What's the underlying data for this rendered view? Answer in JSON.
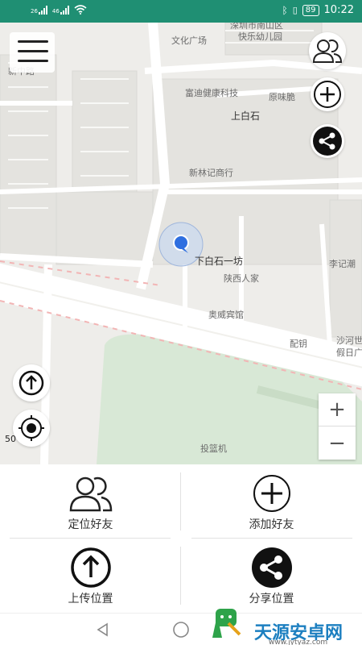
{
  "status_bar": {
    "signal1": "26",
    "signal2": "46",
    "battery": "89",
    "time": "10:22"
  },
  "map": {
    "labels": {
      "shenzhen_nanshan": "深圳市南山区",
      "kuaile_kindergarten": "快乐幼儿园",
      "wenhua_plaza": "文化广场",
      "xinzhong_road": "新中路",
      "fudi_tech": "富迪健康科技",
      "yuanwei": "原味脆",
      "shangbaishi": "上白石",
      "xinlinji": "新林记商行",
      "xiabaishi_1": "下白石一坊",
      "lijichao": "李记潮",
      "shaanxi": "陕西人家",
      "aowei_hotel": "奥威宾馆",
      "peiyao": "配钥",
      "shahe": "沙河世",
      "jiari": "假日广",
      "toulanji": "投篮机"
    },
    "scale": "50",
    "zoom_in": "+",
    "zoom_out": "−",
    "icons": [
      "menu-icon",
      "friends-icon",
      "plus-icon",
      "share-icon",
      "upload-icon",
      "locate-icon",
      "location-marker-icon"
    ]
  },
  "actions": {
    "locate_friends": "定位好友",
    "add_friend": "添加好友",
    "upload_location": "上传位置",
    "share_location": "分享位置"
  },
  "watermark": {
    "name": "天源安卓网",
    "url": "www.jytyaz.com"
  },
  "colors": {
    "status_bar": "#1f8f73",
    "map_bg": "#eeedea",
    "park": "#d8e8d6",
    "marker": "#2f6fe0"
  }
}
